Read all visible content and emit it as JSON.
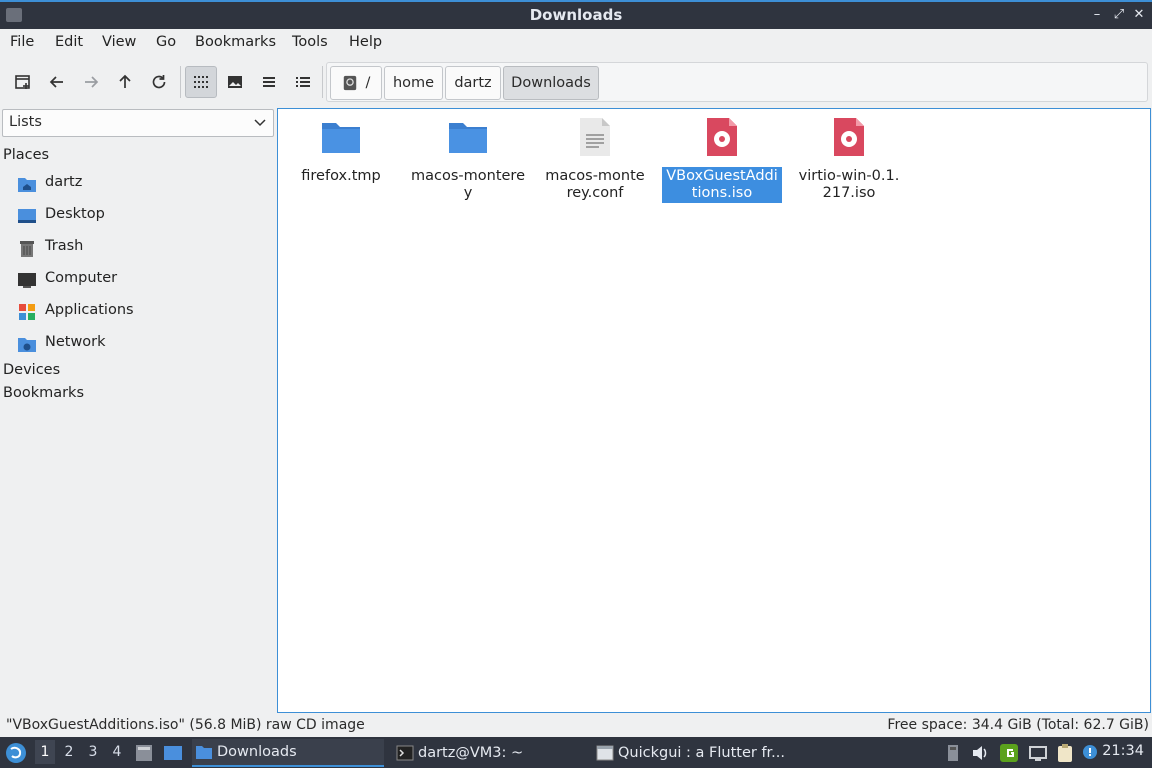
{
  "window": {
    "title": "Downloads",
    "buttons": {
      "minimize": "–",
      "maximize": "⤢",
      "close": "✕"
    }
  },
  "menu": [
    "File",
    "Edit",
    "View",
    "Go",
    "Bookmarks",
    "Tools",
    "Help"
  ],
  "breadcrumbs": [
    "/",
    "home",
    "dartz",
    "Downloads"
  ],
  "sidebar": {
    "view_select": "Lists",
    "places_heading": "Places",
    "places": [
      {
        "label": "dartz",
        "icon": "home-folder-icon"
      },
      {
        "label": "Desktop",
        "icon": "desktop-icon"
      },
      {
        "label": "Trash",
        "icon": "trash-icon"
      },
      {
        "label": "Computer",
        "icon": "computer-icon"
      },
      {
        "label": "Applications",
        "icon": "applications-icon"
      },
      {
        "label": "Network",
        "icon": "network-icon"
      }
    ],
    "devices_heading": "Devices",
    "bookmarks_heading": "Bookmarks"
  },
  "files": [
    {
      "name": "firefox.tmp",
      "icon": "folder-icon"
    },
    {
      "name": "macos-monterey",
      "icon": "folder-icon"
    },
    {
      "name": "macos-monterey.conf",
      "icon": "text-file-icon"
    },
    {
      "name": "VBoxGuestAdditions.iso",
      "icon": "disc-image-icon",
      "selected": true
    },
    {
      "name": "virtio-win-0.1.217.iso",
      "icon": "disc-image-icon"
    }
  ],
  "status": {
    "selection": "\"VBoxGuestAdditions.iso\" (56.8 MiB) raw CD image",
    "free_space": "Free space: 34.4 GiB (Total: 62.7 GiB)"
  },
  "taskbar": {
    "workspaces": [
      "1",
      "2",
      "3",
      "4"
    ],
    "active_workspace": "1",
    "tasks": [
      {
        "label": "Downloads",
        "icon": "folder-icon"
      },
      {
        "label": "dartz@VM3: ~",
        "icon": "terminal-icon"
      },
      {
        "label": "Quickgui : a Flutter fr...",
        "icon": "window-icon"
      }
    ],
    "clock": "21:34"
  },
  "colors": {
    "accent": "#3d8fd6",
    "titlebar": "#2f343f",
    "folder": "#4a8fdd",
    "iso": "#d9485f"
  }
}
